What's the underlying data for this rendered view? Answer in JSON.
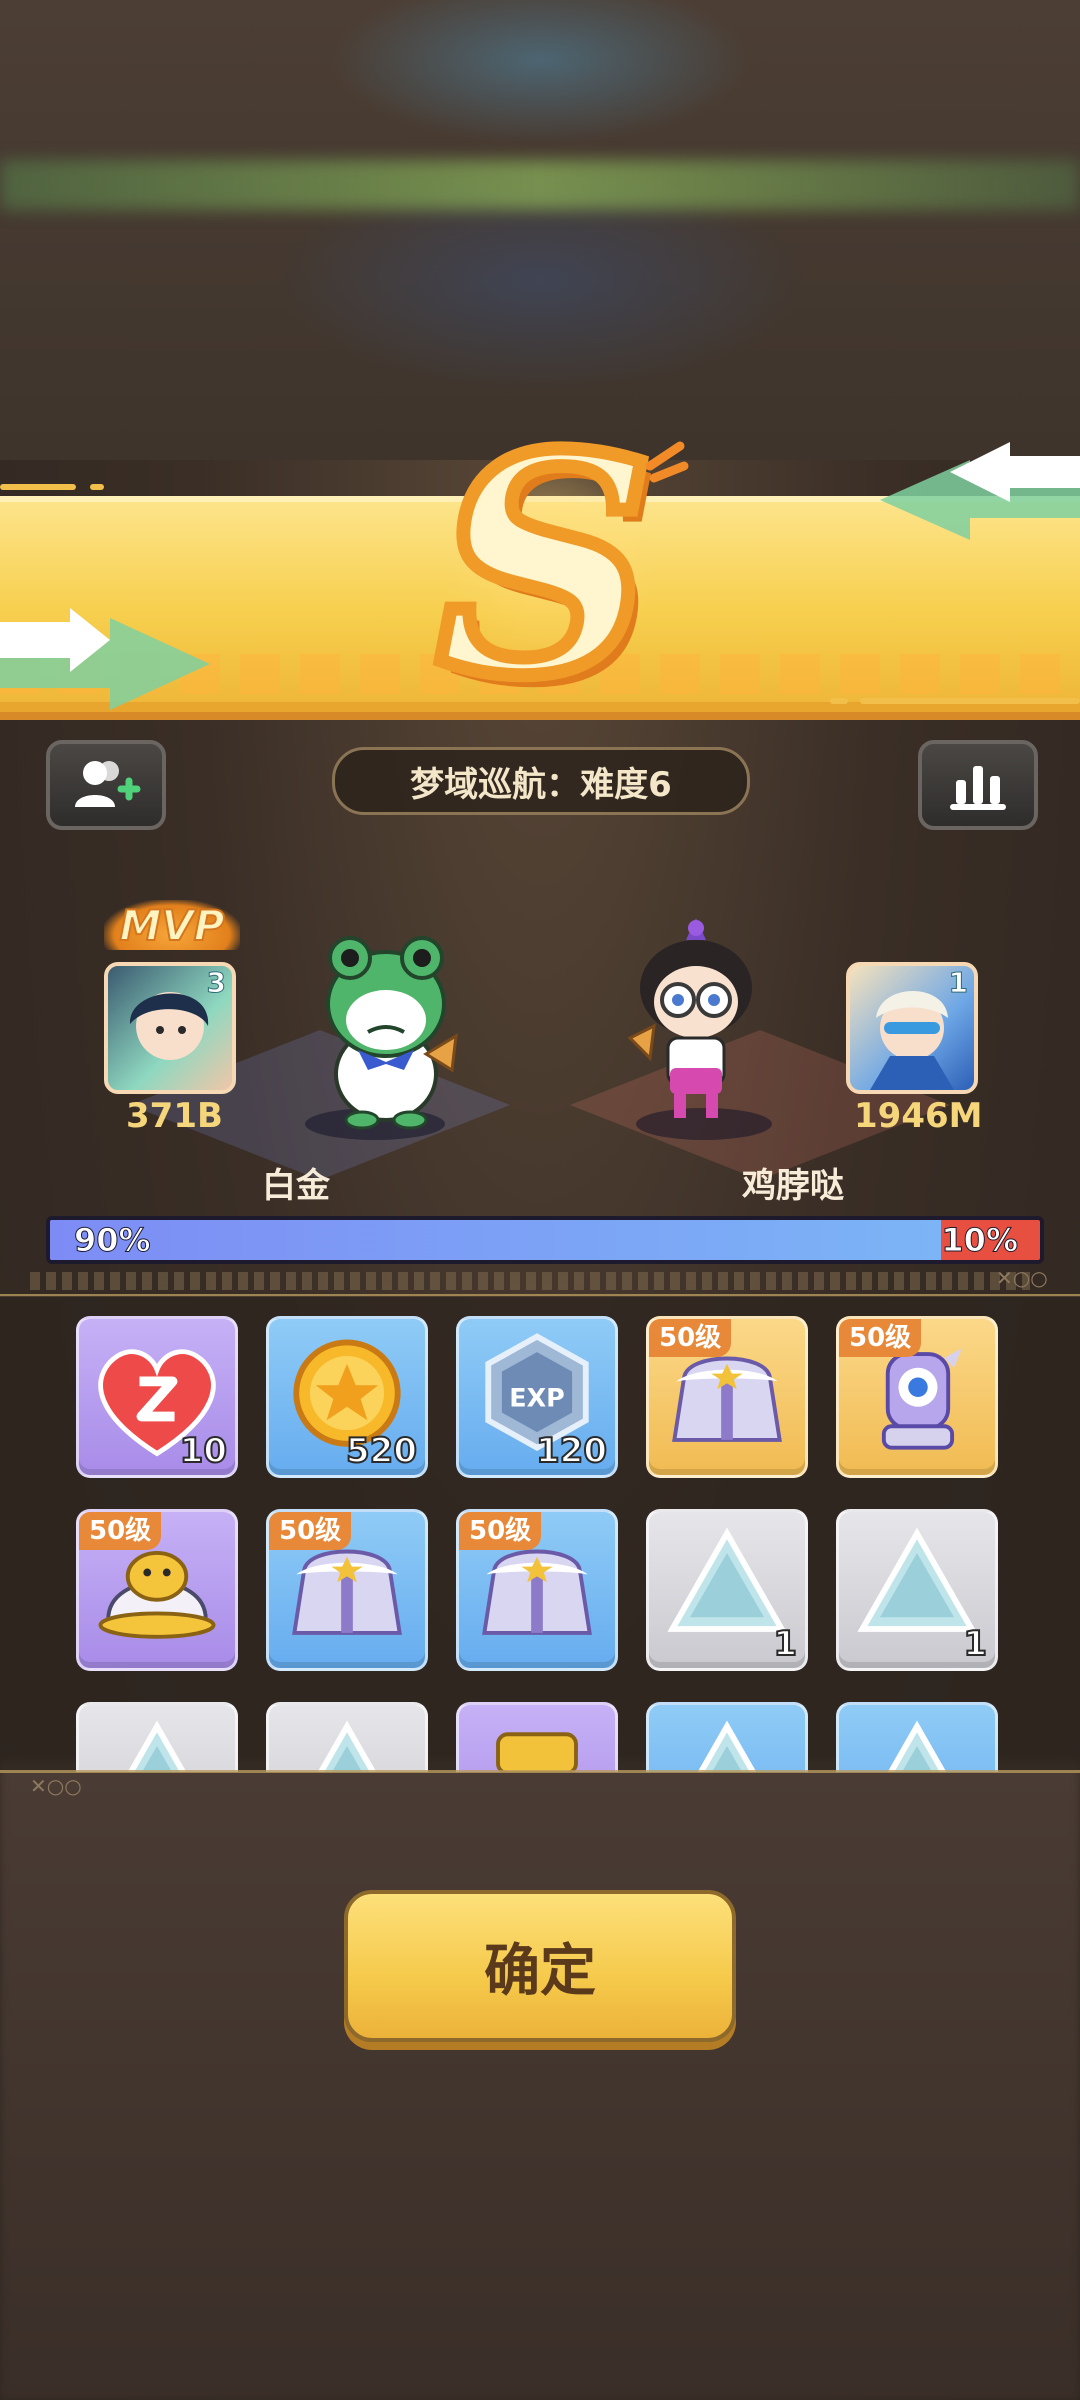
{
  "header": {
    "mode_title": "梦域巡航：难度6",
    "grade": "S"
  },
  "players": {
    "left": {
      "badge": "MVP",
      "level": "3",
      "damage": "371B",
      "name": "白金"
    },
    "right": {
      "level": "1",
      "damage": "1946M",
      "name": "鸡脖哒"
    }
  },
  "contribution": {
    "left_percent": "90%",
    "right_percent": "10%",
    "left_fraction": 0.9
  },
  "rewards": [
    {
      "icon": "heart-z-icon",
      "rarity": "purple",
      "qty": "10",
      "level": ""
    },
    {
      "icon": "gold-coin-icon",
      "rarity": "blue",
      "qty": "520",
      "level": ""
    },
    {
      "icon": "exp-badge-icon",
      "rarity": "blue",
      "qty": "120",
      "level": ""
    },
    {
      "icon": "coat-icon",
      "rarity": "gold",
      "qty": "",
      "level": "50级"
    },
    {
      "icon": "eye-gauntlet-icon",
      "rarity": "gold",
      "qty": "",
      "level": "50级"
    },
    {
      "icon": "duck-helmet-icon",
      "rarity": "purple",
      "qty": "",
      "level": "50级"
    },
    {
      "icon": "coat-icon",
      "rarity": "blue",
      "qty": "",
      "level": "50级"
    },
    {
      "icon": "coat-icon",
      "rarity": "blue",
      "qty": "",
      "level": "50级"
    },
    {
      "icon": "crystal-shard-icon",
      "rarity": "gray",
      "qty": "1",
      "level": ""
    },
    {
      "icon": "crystal-shard-icon",
      "rarity": "gray",
      "qty": "1",
      "level": ""
    },
    {
      "icon": "crystal-shard-icon",
      "rarity": "gray",
      "qty": "",
      "level": ""
    },
    {
      "icon": "crystal-shard-icon",
      "rarity": "gray",
      "qty": "",
      "level": ""
    },
    {
      "icon": "weapon-icon",
      "rarity": "purple",
      "qty": "",
      "level": ""
    },
    {
      "icon": "crystal-shard-icon",
      "rarity": "blue",
      "qty": "",
      "level": ""
    },
    {
      "icon": "crystal-shard-icon",
      "rarity": "blue",
      "qty": "",
      "level": ""
    }
  ],
  "confirm_label": "确定",
  "colors": {
    "banner": "#f7cf4e",
    "bar_left": "#7d8cf5",
    "bar_right": "#e75040",
    "confirm": "#f5c94a"
  }
}
